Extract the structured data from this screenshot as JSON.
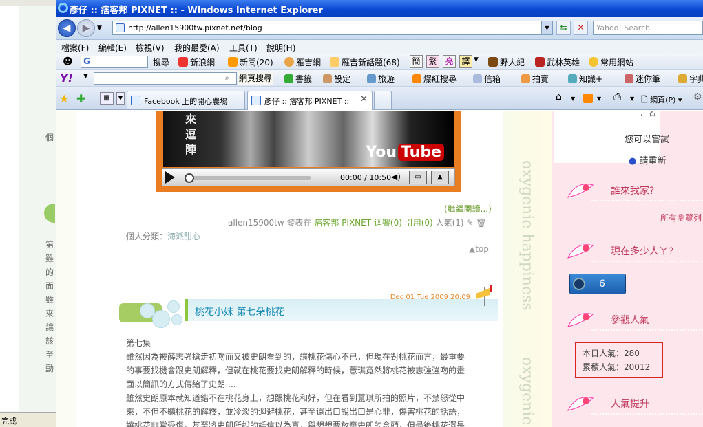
{
  "background_window": {
    "status": "完成",
    "column_top": "個",
    "column_chars": [
      "第",
      "雖",
      "的",
      "面",
      "雖",
      "來",
      "讓",
      "該",
      "至",
      "動"
    ]
  },
  "window": {
    "title": "彥仔 :: 痞客邦 PIXNET :: - Windows Internet Explorer",
    "url": "http://allen15900tw.pixnet.net/blog",
    "search_placeholder": "Yahoo! Search"
  },
  "menu": [
    "檔案(F)",
    "編輯(E)",
    "檢視(V)",
    "我的最愛(A)",
    "工具(T)",
    "說明(H)"
  ],
  "toolbar1": {
    "google_box": "G",
    "search_label": "搜尋",
    "links": [
      "新浪網",
      "新聞(20)",
      "雁吉網",
      "雁吉新話題(68)"
    ],
    "chinese_buttons": [
      "簡",
      "繁",
      "亮",
      "譯"
    ],
    "more_links": [
      "野人紀",
      "武林英雄",
      "常用網站"
    ]
  },
  "toolbar2": {
    "yahoo_logo": "Y!",
    "search_button": "網頁搜尋",
    "items": [
      "書籤",
      "設定",
      "旅遊",
      "爆紅搜尋",
      "信箱",
      "拍賣",
      "知識+",
      "迷你筆",
      "字典"
    ]
  },
  "tabs": [
    {
      "label": "Facebook 上的開心農場",
      "active": false
    },
    {
      "label": "彥仔 :: 痞客邦 PIXNET ::",
      "active": true
    }
  ],
  "right_commands": {
    "page_label": "網頁(P)"
  },
  "video": {
    "subtitle_chars": [
      "來",
      "逗",
      "陣"
    ],
    "brand": "You",
    "brand_tube": "Tube",
    "time": "00:00 / 10:50"
  },
  "post_prev": {
    "more_link": "(繼續閱讀...)",
    "author": "allen15900tw",
    "posted_in": "發表在",
    "site": "痞客邦 PIXNET",
    "replies": "迴響(0)",
    "trackbacks": "引用(0)",
    "popularity": "人氣(1)",
    "category_label": "個人分類：",
    "category": "海派甜心",
    "top_link": "▲top"
  },
  "post": {
    "date": "Dec 01 Tue 2009 20:09",
    "title": "桃花小妹 第七朵桃花",
    "episode": "第七集",
    "lines": [
      "雖然因為被薛志強搶走初吻而又被史朗看到的，讓桃花傷心不已，但現在對桃花而言，最重要",
      "的事要找機會跟史朗解釋，但就在桃花要找史朗解釋的時候，薏琪竟然將桃花被志強強吻的畫",
      "面以簡訊的方式傳給了史朗 …",
      "雖然史朗原本就知道錯不在桃花身上，想跟桃花和好，但在看到薏琪所拍的照片，不禁怒從中",
      "來，不但不聽桃花的解釋，並冷淡的迴避桃花，甚至還出口說出口是心非，傷害桃花的話語，",
      "讓桃花非常受傷，甚至將史朗所說的話信以為真，與想想要放棄史朗的念頭，但最後桃花還是"
    ]
  },
  "deco_text": [
    "oxygenie happiness",
    "oxygenie"
  ],
  "sidebar": {
    "partial_top": "．名",
    "try_text": "您可以嘗試",
    "reload_text": "請重新",
    "widgets": [
      {
        "title": "誰來我家?",
        "note": "所有瀏覽列"
      },
      {
        "title": "現在多少人ㄚ?",
        "count": "6"
      },
      {
        "title": "參觀人氣",
        "today_label": "本日人氣：",
        "today_value": "280",
        "total_label": "累積人氣：",
        "total_value": "20012"
      },
      {
        "title": "人氣提升"
      }
    ]
  }
}
